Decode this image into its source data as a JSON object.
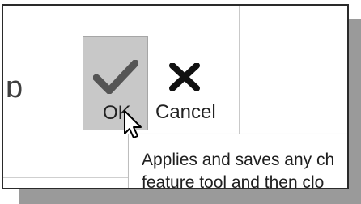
{
  "toolbar": {
    "ok_label": "OK",
    "cancel_label": "Cancel",
    "ok_icon": "checkmark-icon",
    "cancel_icon": "x-close-icon"
  },
  "tooltip": {
    "line1": "Applies and saves any ch",
    "line2": "feature tool and then clo"
  },
  "colors": {
    "ok_button_bg": "#c8c8c8",
    "checkmark": "#555555",
    "x_icon": "#111111"
  }
}
